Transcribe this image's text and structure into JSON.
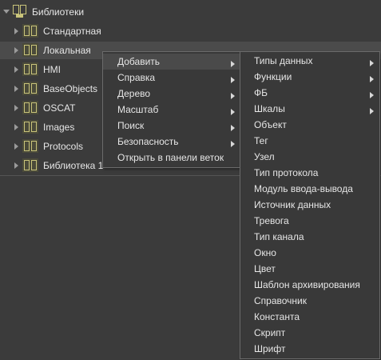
{
  "tree": {
    "root_label": "Библиотеки",
    "items": [
      {
        "label": "Стандартная"
      },
      {
        "label": "Локальная"
      },
      {
        "label": "HMI"
      },
      {
        "label": "BaseObjects"
      },
      {
        "label": "OSCAT"
      },
      {
        "label": "Images"
      },
      {
        "label": "Protocols"
      },
      {
        "label": "Библиотека 1"
      }
    ]
  },
  "context_menu": {
    "items": [
      {
        "label": "Добавить",
        "submenu": true
      },
      {
        "label": "Справка",
        "submenu": true
      },
      {
        "label": "Дерево",
        "submenu": true
      },
      {
        "label": "Масштаб",
        "submenu": true
      },
      {
        "label": "Поиск",
        "submenu": true
      },
      {
        "label": "Безопасность",
        "submenu": true
      },
      {
        "label": "Открыть в панели веток",
        "submenu": false
      }
    ]
  },
  "add_submenu": {
    "items": [
      {
        "label": "Типы данных",
        "submenu": true
      },
      {
        "label": "Функции",
        "submenu": true
      },
      {
        "label": "ФБ",
        "submenu": true
      },
      {
        "label": "Шкалы",
        "submenu": true
      },
      {
        "label": "Объект",
        "submenu": false
      },
      {
        "label": "Тег",
        "submenu": false
      },
      {
        "label": "Узел",
        "submenu": false
      },
      {
        "label": "Тип протокола",
        "submenu": false
      },
      {
        "label": "Модуль ввода-вывода",
        "submenu": false
      },
      {
        "label": "Источник данных",
        "submenu": false
      },
      {
        "label": "Тревога",
        "submenu": false
      },
      {
        "label": "Тип канала",
        "submenu": false
      },
      {
        "label": "Окно",
        "submenu": false
      },
      {
        "label": "Цвет",
        "submenu": false
      },
      {
        "label": "Шаблон архивирования",
        "submenu": false
      },
      {
        "label": "Справочник",
        "submenu": false
      },
      {
        "label": "Константа",
        "submenu": false
      },
      {
        "label": "Скрипт",
        "submenu": false
      },
      {
        "label": "Шрифт",
        "submenu": false
      }
    ]
  },
  "colors": {
    "background": "#3b3b3b",
    "icon_fill": "#c9c47a",
    "text": "#e6e6e6"
  }
}
